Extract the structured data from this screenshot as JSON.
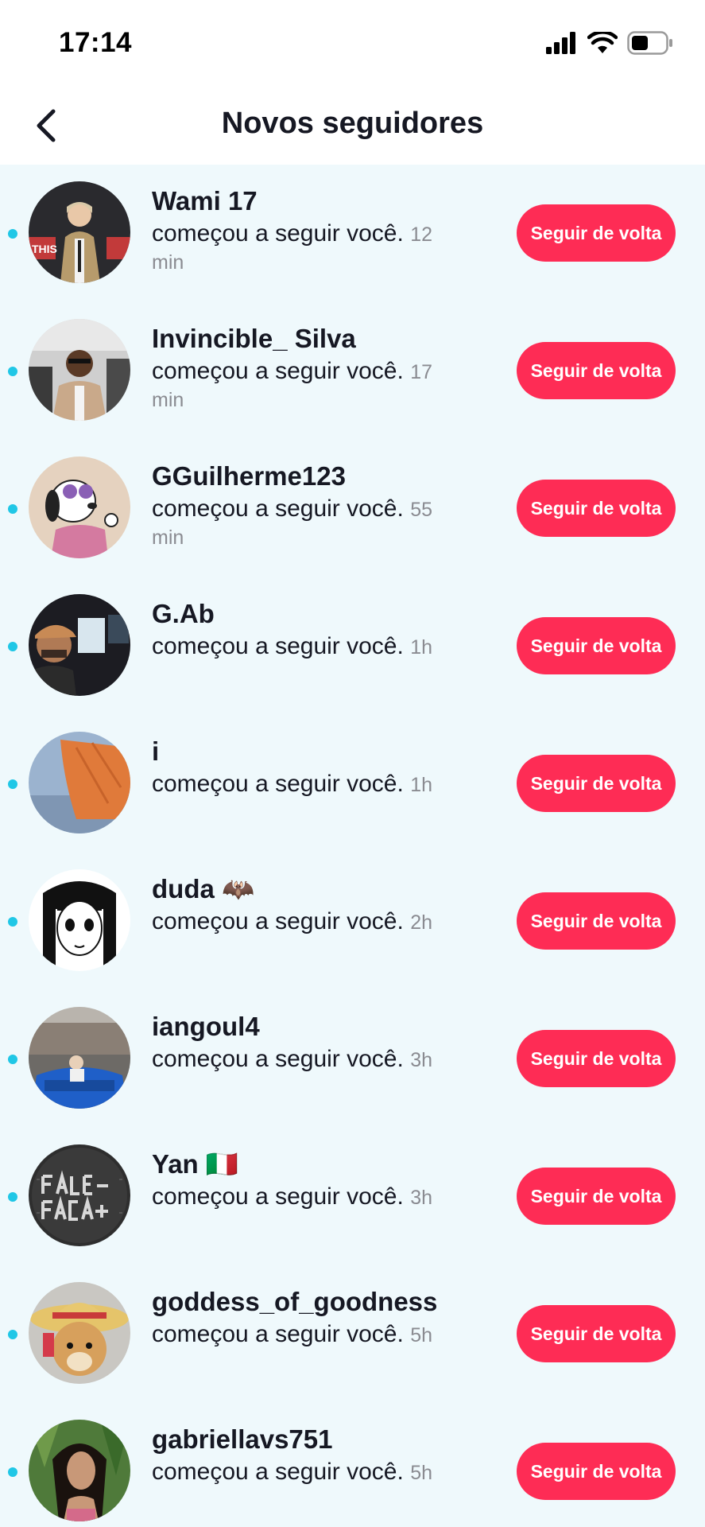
{
  "status_bar": {
    "time": "17:14"
  },
  "header": {
    "title": "Novos seguidores"
  },
  "notifications": [
    {
      "username": "Wami 17",
      "action": "começou a seguir você.",
      "time": "12 min",
      "button": "Seguir de volta"
    },
    {
      "username": "Invincible_ Silva",
      "action": "começou a seguir você.",
      "time": "17 min",
      "button": "Seguir de volta"
    },
    {
      "username": "GGuilherme123",
      "action": "começou a seguir você.",
      "time": "55 min",
      "button": "Seguir de volta"
    },
    {
      "username": "G.Ab",
      "action": "começou a seguir você.",
      "time": "1h",
      "button": "Seguir de volta"
    },
    {
      "username": "i",
      "action": "começou a seguir você.",
      "time": "1h",
      "button": "Seguir de volta"
    },
    {
      "username": "duda 🦇",
      "action": "começou a seguir você.",
      "time": "2h",
      "button": "Seguir de volta"
    },
    {
      "username": "iangoul4",
      "action": "começou a seguir você.",
      "time": "3h",
      "button": "Seguir de volta"
    },
    {
      "username": "Yan 🇮🇹",
      "action": "começou a seguir você.",
      "time": "3h",
      "button": "Seguir de volta"
    },
    {
      "username": "goddess_of_goodness",
      "action": "começou a seguir você.",
      "time": "5h",
      "button": "Seguir de volta"
    },
    {
      "username": "gabriellavs751",
      "action": "começou a seguir você.",
      "time": "5h",
      "button": "Seguir de volta"
    }
  ],
  "colors": {
    "accent": "#fe2c55",
    "list_background": "#eff9fc",
    "unread_dot": "#20c7e6",
    "time_text": "#8a8b91"
  }
}
